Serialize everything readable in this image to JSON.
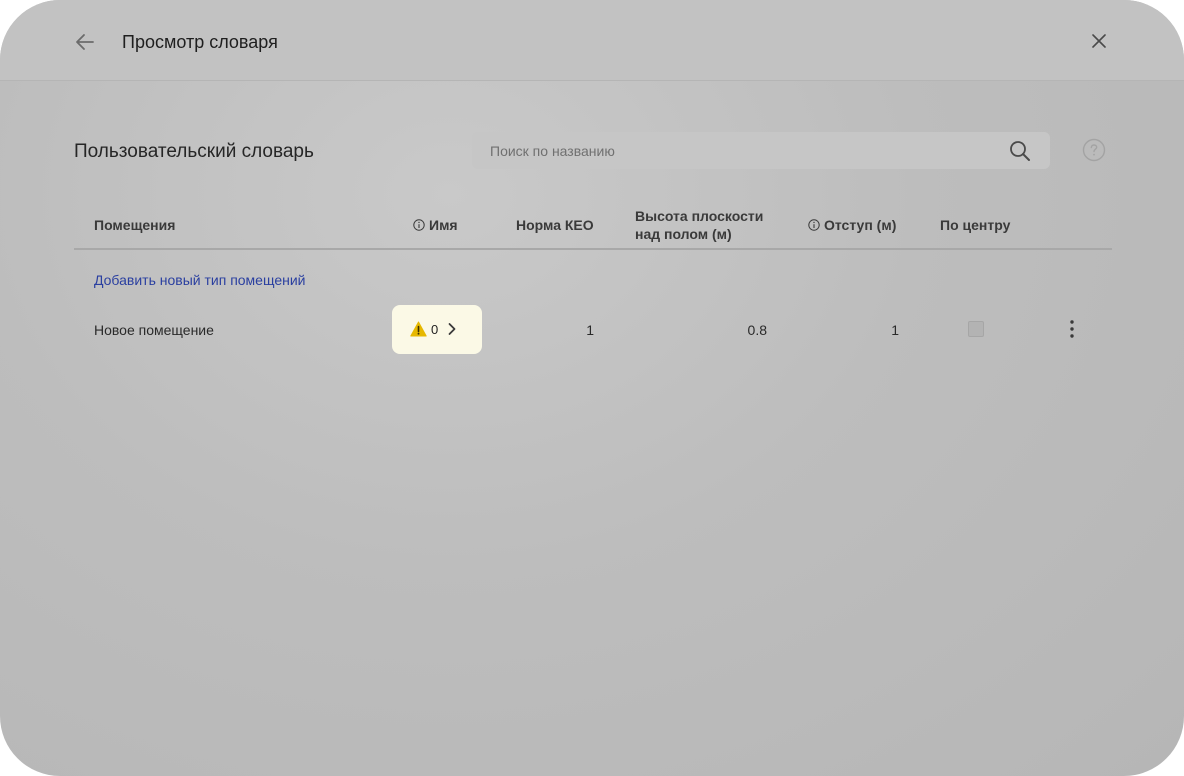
{
  "dialog": {
    "title": "Просмотр словаря"
  },
  "toolbar": {
    "back_icon": "arrow-left-icon",
    "close_icon": "close-icon"
  },
  "section": {
    "title": "Пользовательский словарь"
  },
  "search": {
    "placeholder": "Поиск по названию",
    "value": "",
    "icon": "search-icon"
  },
  "help": {
    "icon": "question-circle-icon"
  },
  "table": {
    "columns": {
      "rooms": "Помещения",
      "name": "Имя",
      "keo_norm": "Норма КЕО",
      "plane_height_line1": "Высота плоскости",
      "plane_height_line2": "над полом (м)",
      "offset": "Отступ (м)",
      "centered": "По центру"
    },
    "add_link": "Добавить новый тип помещений",
    "rows": [
      {
        "room": "Новое помещение",
        "name_warnings": "0",
        "keo_norm": "1",
        "plane_height": "0.8",
        "offset": "1",
        "centered": false
      }
    ]
  },
  "colors": {
    "link": "#2a3fa0",
    "warning": "#e6b800",
    "badge_bg": "#fbf9e6"
  }
}
